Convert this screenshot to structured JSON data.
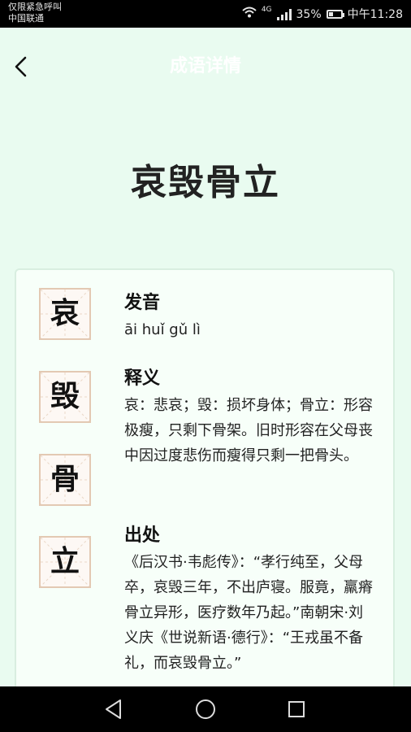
{
  "status_bar": {
    "carrier_line1": "仅限紧急呼叫",
    "carrier_line2": "中国联通",
    "network": "4G",
    "battery": "35%",
    "battery_level": 0.35,
    "time": "中午11:28"
  },
  "header": {
    "title": "成语详情"
  },
  "idiom": {
    "title": "哀毁骨立",
    "chars": [
      "哀",
      "毁",
      "骨",
      "立"
    ]
  },
  "sections": [
    {
      "heading": "发音",
      "body": "āi huǐ gǔ lì"
    },
    {
      "heading": "释义",
      "body": "哀：悲哀；毁：损坏身体；骨立：形容极瘦，只剩下骨架。旧时形容在父母丧中因过度悲伤而瘦得只剩一把骨头。"
    },
    {
      "heading": "出处",
      "body": "《后汉书·韦彪传》：“孝行纯至，父母卒，哀毁三年，不出庐寝。服竟，羸瘠骨立异形，医疗数年乃起。”南朝宋·刘义庆《世说新语·德行》：“王戎虽不备礼，而哀毁骨立。”"
    }
  ],
  "colors": {
    "background": "#e9fbf0",
    "char_box_border": "#e3c9b3"
  }
}
